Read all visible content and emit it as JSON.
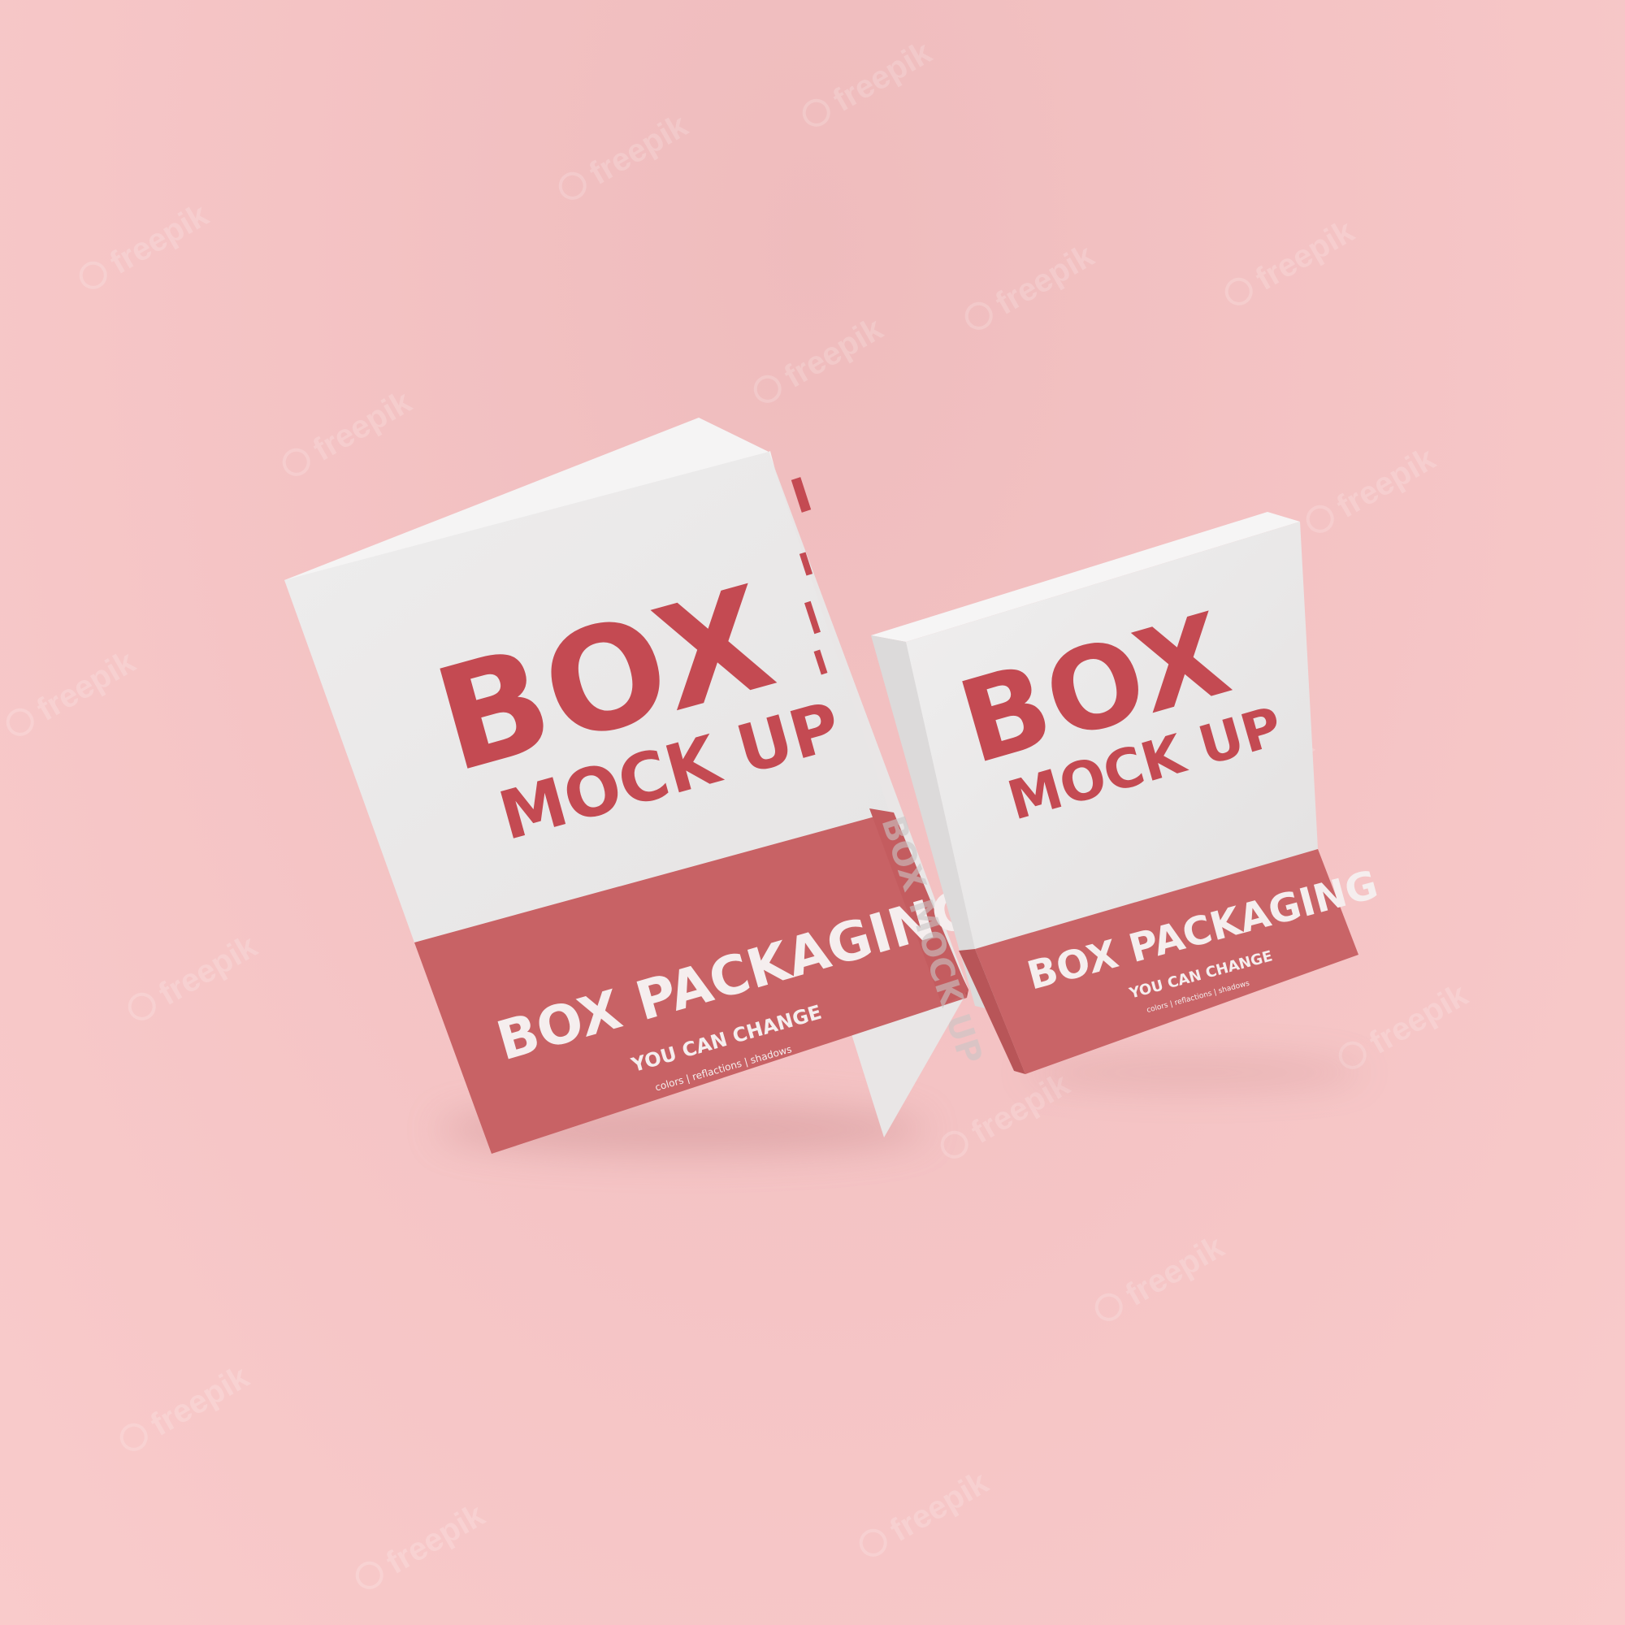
{
  "colors": {
    "background": "#f4c3c4",
    "box_white": "#ecebeb",
    "box_red": "#c86063",
    "title_red": "#c44a52",
    "band_text": "#f3e6e6"
  },
  "large_box": {
    "title": "BOX",
    "subtitle": "MOCK UP",
    "band_title": "BOX PACKAGING",
    "band_tagline": "YOU CAN CHANGE",
    "band_options": "colors  |  reflactions  |  shadows",
    "side_text": "BOX MOCK UP"
  },
  "small_box": {
    "title": "BOX",
    "subtitle": "MOCK UP",
    "band_title": "BOX PACKAGING",
    "band_tagline": "YOU CAN CHANGE",
    "band_options": "colors  |  reflactions  |  shadows"
  },
  "watermark": {
    "text": "freepik"
  }
}
